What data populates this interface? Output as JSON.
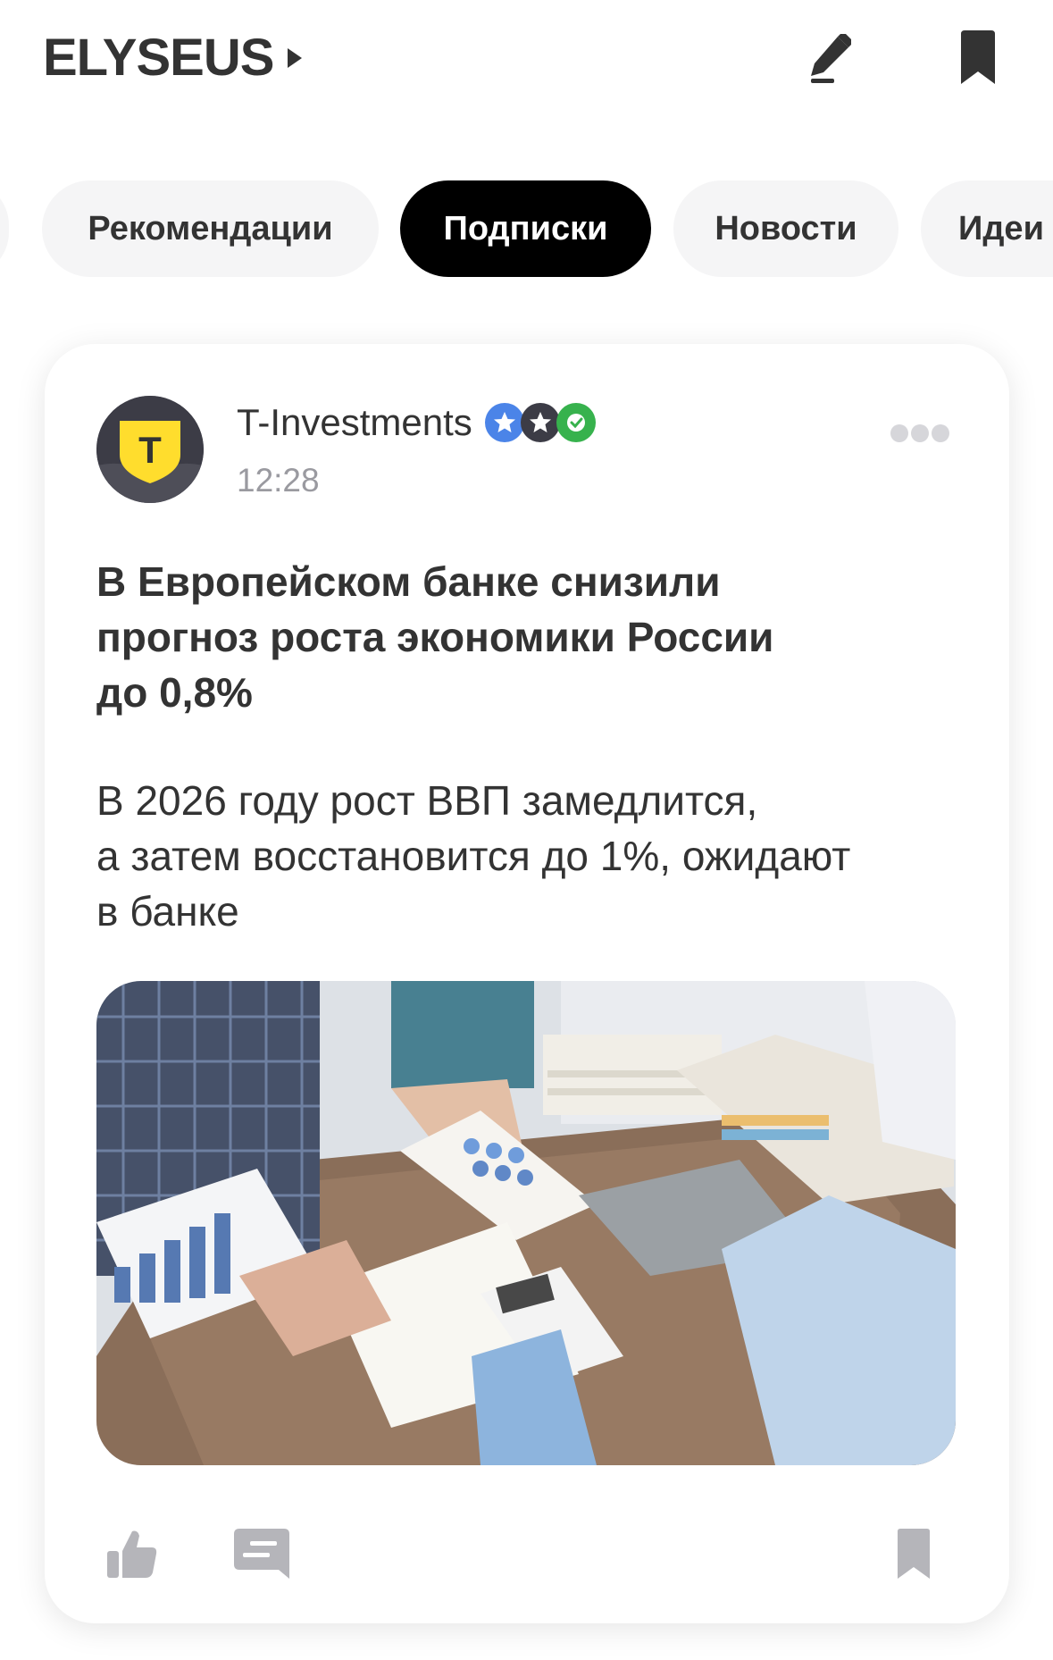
{
  "header": {
    "brand": "ELYSEUS",
    "icons": {
      "brand_menu": "triangle-right-icon",
      "edit": "pencil-icon",
      "bookmarks": "bookmark-icon"
    }
  },
  "tabs": [
    {
      "label": "Рекомендации",
      "active": false
    },
    {
      "label": "Подписки",
      "active": true
    },
    {
      "label": "Новости",
      "active": false
    },
    {
      "label": "Идеи",
      "active": false
    }
  ],
  "post": {
    "author": "T-Investments",
    "avatar_letter": "T",
    "badges": [
      "star-badge-icon",
      "star-badge-icon",
      "verified-check-icon"
    ],
    "time": "12:28",
    "headline_lines": [
      "В Европейском банке снизили",
      "прогноз роста экономики России",
      "до 0,8%"
    ],
    "body_lines": [
      "В 2026 году рост ВВП замедлится,",
      "а затем восстановится до 1%, ожидают",
      "в банке"
    ],
    "image": "office-meeting-photo",
    "actions": [
      "like-icon",
      "comment-icon",
      "bookmark-icon"
    ]
  },
  "colors": {
    "accent": "#000000",
    "text": "#333333",
    "muted": "#9a9aa0",
    "tab_bg": "#f5f5f6",
    "badge_blue": "#4b84e8",
    "badge_dark": "#3c3c46",
    "badge_green": "#37b24d",
    "brand_yellow": "#ffdd2d",
    "icon_gray": "#b5b5ba"
  }
}
